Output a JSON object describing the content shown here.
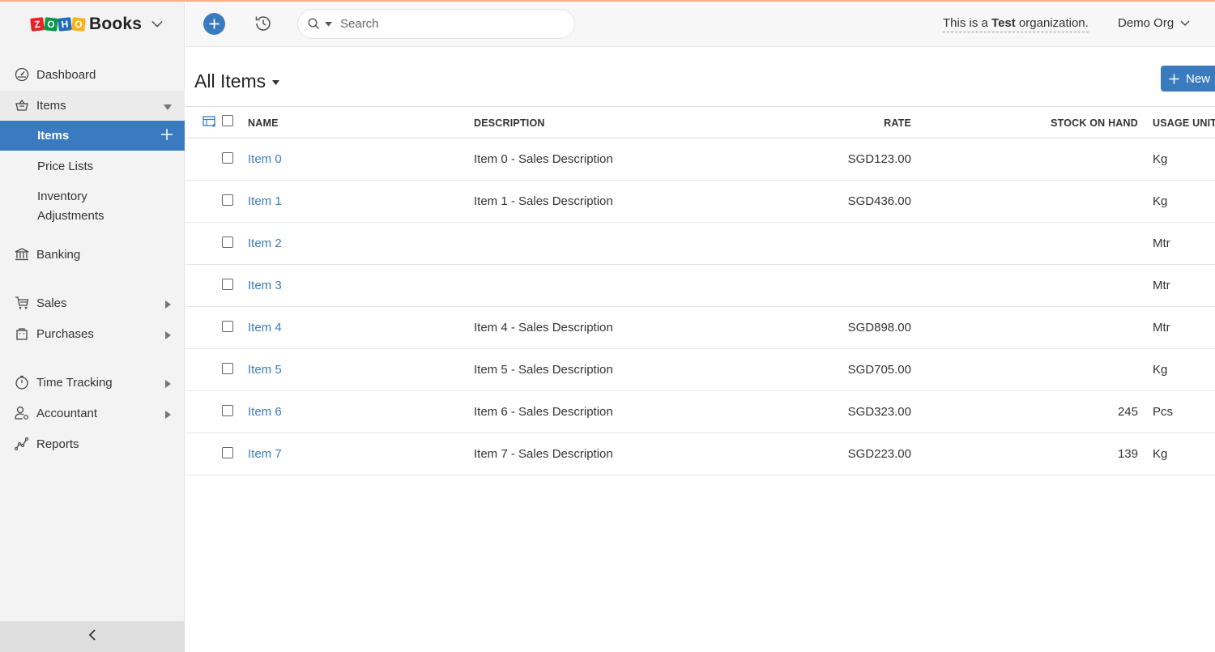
{
  "brand": {
    "logo_letters": [
      "Z",
      "O",
      "H",
      "O"
    ],
    "name": "Books"
  },
  "header": {
    "search_placeholder": "Search",
    "test_org_prefix": "This is a ",
    "test_org_bold": "Test",
    "test_org_suffix": " organization.",
    "org_name": "Demo Org"
  },
  "sidebar": {
    "items": [
      {
        "label": "Dashboard",
        "icon": "dashboard-icon"
      },
      {
        "label": "Items",
        "icon": "basket-icon",
        "expanded": true
      },
      {
        "label": "Banking",
        "icon": "bank-icon"
      },
      {
        "label": "Sales",
        "icon": "cart-icon"
      },
      {
        "label": "Purchases",
        "icon": "bag-icon"
      },
      {
        "label": "Time Tracking",
        "icon": "stopwatch-icon"
      },
      {
        "label": "Accountant",
        "icon": "accountant-icon"
      },
      {
        "label": "Reports",
        "icon": "reports-icon"
      }
    ],
    "subitems": [
      {
        "label": "Items",
        "active": true
      },
      {
        "label": "Price Lists"
      },
      {
        "label_line1": "Inventory",
        "label_line2": "Adjustments"
      }
    ]
  },
  "main": {
    "title": "All Items",
    "new_label": "New",
    "columns": [
      "NAME",
      "DESCRIPTION",
      "RATE",
      "STOCK ON HAND",
      "USAGE UNIT"
    ],
    "rows": [
      {
        "name": "Item 0",
        "description": "Item 0 - Sales Description",
        "rate": "SGD123.00",
        "stock": "",
        "unit": "Kg"
      },
      {
        "name": "Item 1",
        "description": "Item 1 - Sales Description",
        "rate": "SGD436.00",
        "stock": "",
        "unit": "Kg"
      },
      {
        "name": "Item 2",
        "description": "",
        "rate": "",
        "stock": "",
        "unit": "Mtr"
      },
      {
        "name": "Item 3",
        "description": "",
        "rate": "",
        "stock": "",
        "unit": "Mtr"
      },
      {
        "name": "Item 4",
        "description": "Item 4 - Sales Description",
        "rate": "SGD898.00",
        "stock": "",
        "unit": "Mtr"
      },
      {
        "name": "Item 5",
        "description": "Item 5 - Sales Description",
        "rate": "SGD705.00",
        "stock": "",
        "unit": "Kg"
      },
      {
        "name": "Item 6",
        "description": "Item 6 - Sales Description",
        "rate": "SGD323.00",
        "stock": "245",
        "unit": "Pcs"
      },
      {
        "name": "Item 7",
        "description": "Item 7 - Sales Description",
        "rate": "SGD223.00",
        "stock": "139",
        "unit": "Kg"
      }
    ]
  },
  "colors": {
    "accent": "#3a7bbf",
    "top_line": "#f4b183",
    "sidebar_bg": "#f3f3f3"
  }
}
